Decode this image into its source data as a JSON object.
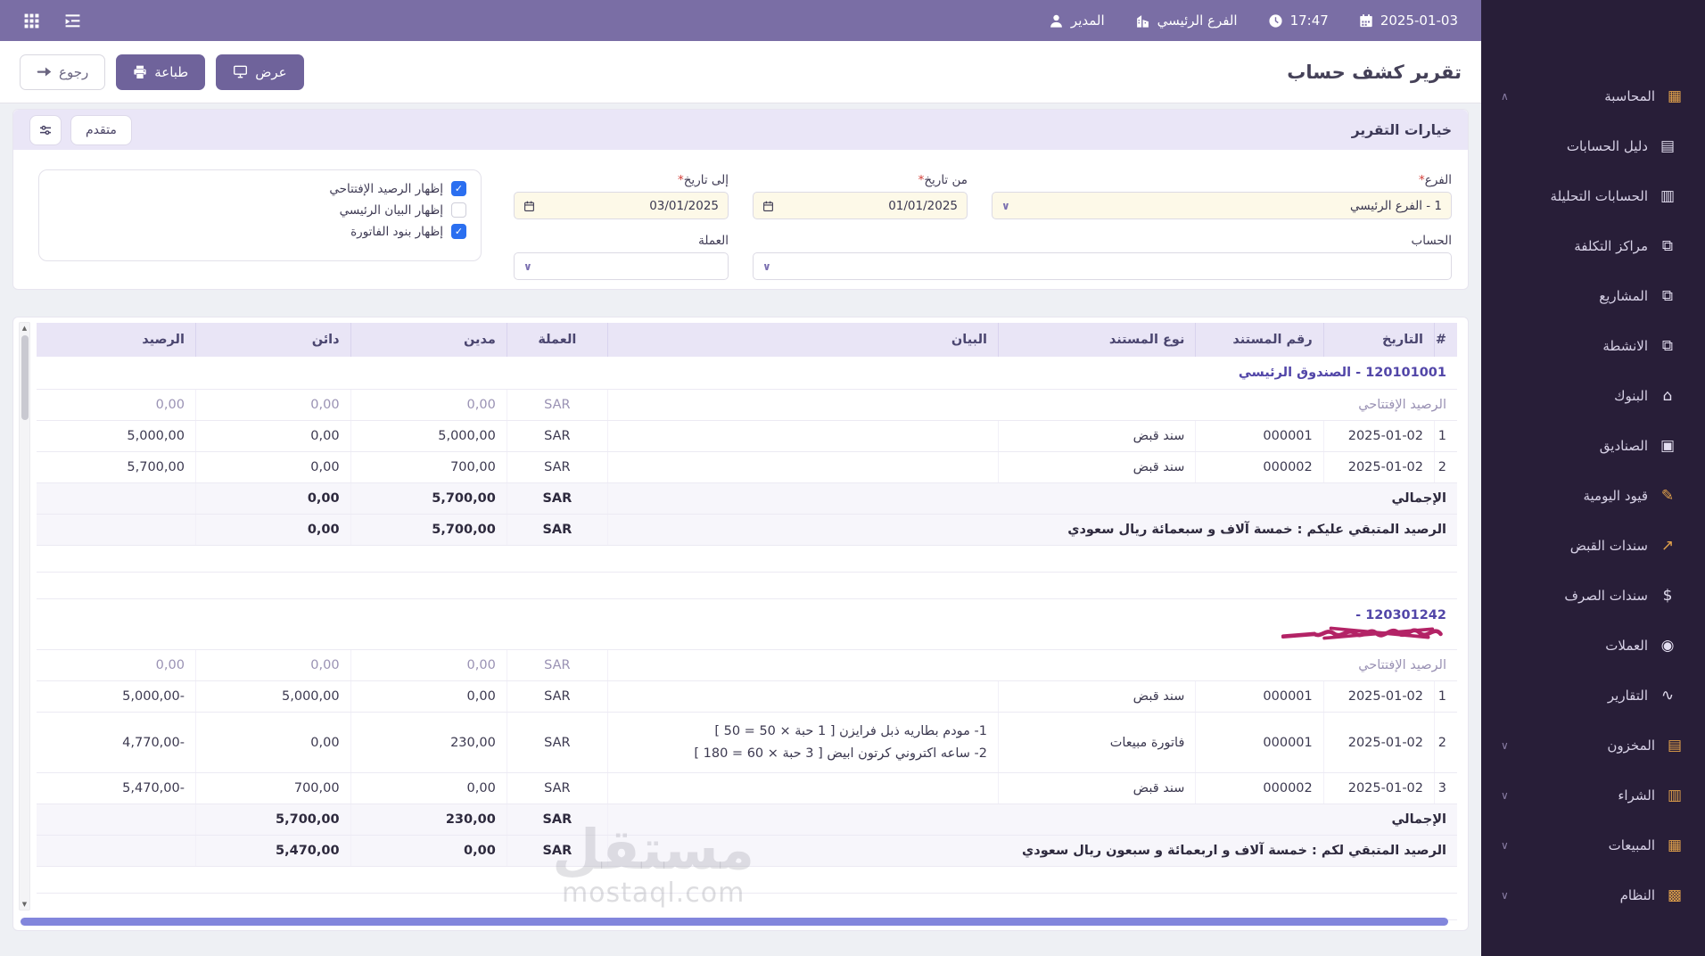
{
  "colors": {
    "accent": "#6F639B",
    "topbar": "#7A6EA5",
    "sidebar": "#281E38",
    "options_header": "#EAE6F7",
    "checkbox_checked": "#2B6FF0",
    "highlight_input": "#FDF9E8",
    "account_link": "#5246A8",
    "scribble": "#B32366",
    "hscrollbar": "#8286DC"
  },
  "topbar": {
    "user": "المدير",
    "branch": "الفرع الرئيسي",
    "time": "17:47",
    "date": "2025-01-03"
  },
  "toolbar": {
    "title": "تقرير كشف حساب",
    "view_label": "عرض",
    "print_label": "طباعة",
    "back_label": "رجوع"
  },
  "options": {
    "header": "خيارات التقرير",
    "advanced_label": "متقدم",
    "required_mark": "*",
    "fields": {
      "branch": {
        "label": "الفرع",
        "required": true,
        "value": "1 - الفرع الرئيسي"
      },
      "account": {
        "label": "الحساب",
        "value": ""
      },
      "from_date": {
        "label": "من تاريخ",
        "required": true,
        "value": "01/01/2025"
      },
      "to_date": {
        "label": "إلى تاريخ",
        "required": true,
        "value": "03/01/2025"
      },
      "currency": {
        "label": "العملة",
        "value": ""
      }
    },
    "checkboxes": [
      {
        "key": "show-opening-balance",
        "label": "إظهار الرصيد الإفتتاحي",
        "checked": true
      },
      {
        "key": "show-main-statement",
        "label": "إظهار البيان الرئيسي",
        "checked": false
      },
      {
        "key": "show-invoice-items",
        "label": "إظهار بنود الفاتورة",
        "checked": true
      }
    ]
  },
  "table": {
    "columns": [
      "#",
      "التاريخ",
      "رقم المستند",
      "نوع المستند",
      "البيان",
      "العملة",
      "مدين",
      "دائن",
      "الرصيد"
    ],
    "sections": [
      {
        "account": "120101001 - الصندوق الرئيسي",
        "redacted": false,
        "opening": {
          "label": "الرصيد الإفتتاحي",
          "currency": "SAR",
          "debit": "0,00",
          "credit": "0,00",
          "balance": "0,00"
        },
        "rows": [
          {
            "n": "1",
            "date": "2025-01-02",
            "doc_no": "000001",
            "doc_type": "سند قبض",
            "desc": [],
            "currency": "SAR",
            "debit": "5,000,00",
            "credit": "0,00",
            "balance": "5,000,00"
          },
          {
            "n": "2",
            "date": "2025-01-02",
            "doc_no": "000002",
            "doc_type": "سند قبض",
            "desc": [],
            "currency": "SAR",
            "debit": "700,00",
            "credit": "0,00",
            "balance": "5,700,00"
          }
        ],
        "total": {
          "label": "الإجمالي",
          "currency": "SAR",
          "debit": "5,700,00",
          "credit": "0,00",
          "balance": ""
        },
        "remaining": {
          "label": "الرصيد المتبقي عليكم : خمسة آلاف و سبعمائة ريال سعودي",
          "currency": "SAR",
          "debit": "5,700,00",
          "credit": "0,00",
          "balance": ""
        }
      },
      {
        "account": "120301242 - ",
        "redacted": true,
        "opening": {
          "label": "الرصيد الإفتتاحي",
          "currency": "SAR",
          "debit": "0,00",
          "credit": "0,00",
          "balance": "0,00"
        },
        "rows": [
          {
            "n": "1",
            "date": "2025-01-02",
            "doc_no": "000001",
            "doc_type": "سند قبض",
            "desc": [],
            "currency": "SAR",
            "debit": "0,00",
            "credit": "5,000,00",
            "balance": "5,000,00-"
          },
          {
            "n": "2",
            "date": "2025-01-02",
            "doc_no": "000001",
            "doc_type": "فاتورة مبيعات",
            "desc": [
              "1- مودم بطاريه ذبل فرايزن [ 1 حبة × 50 = 50 ]",
              "2- ساعه اكتروني كرتون ابيض [ 3 حبة × 60 = 180 ]"
            ],
            "currency": "SAR",
            "debit": "230,00",
            "credit": "0,00",
            "balance": "4,770,00-"
          },
          {
            "n": "3",
            "date": "2025-01-02",
            "doc_no": "000002",
            "doc_type": "سند قبض",
            "desc": [],
            "currency": "SAR",
            "debit": "0,00",
            "credit": "700,00",
            "balance": "5,470,00-"
          }
        ],
        "total": {
          "label": "الإجمالي",
          "currency": "SAR",
          "debit": "230,00",
          "credit": "5,700,00",
          "balance": ""
        },
        "remaining": {
          "label": "الرصيد المتبقي لكم : خمسة آلاف و اربعمائة و سبعون ريال سعودي",
          "currency": "SAR",
          "debit": "0,00",
          "credit": "5,470,00",
          "balance": ""
        }
      }
    ],
    "watermark": {
      "line1": "مستقل",
      "line2": "mostaql.com"
    }
  },
  "sidebar": {
    "items": [
      {
        "key": "accounting",
        "label": "المحاسبة",
        "icon": "accounting-icon",
        "chevron": "up",
        "sub": false,
        "colored": true
      },
      {
        "key": "chart-of-accounts",
        "label": "دليل الحسابات",
        "icon": "chart-of-accounts-icon",
        "chevron": null,
        "sub": true,
        "colored": false
      },
      {
        "key": "analytic-accounts",
        "label": "الحسابات التحليلة",
        "icon": "analytic-accounts-icon",
        "chevron": null,
        "sub": true,
        "colored": false
      },
      {
        "key": "cost-centers",
        "label": "مراكز التكلفة",
        "icon": "cost-centers-icon",
        "chevron": null,
        "sub": true,
        "colored": false
      },
      {
        "key": "projects",
        "label": "المشاريع",
        "icon": "projects-icon",
        "chevron": null,
        "sub": true,
        "colored": false
      },
      {
        "key": "activities",
        "label": "الانشطة",
        "icon": "activities-icon",
        "chevron": null,
        "sub": true,
        "colored": false
      },
      {
        "key": "banks",
        "label": "البنوك",
        "icon": "banks-icon",
        "chevron": null,
        "sub": true,
        "colored": false
      },
      {
        "key": "safes",
        "label": "الصناديق",
        "icon": "safes-icon",
        "chevron": null,
        "sub": true,
        "colored": false
      },
      {
        "key": "journal-entries",
        "label": "قيود اليومية",
        "icon": "journal-entries-icon",
        "chevron": null,
        "sub": true,
        "colored": true
      },
      {
        "key": "receipt-vouchers",
        "label": "سندات القبض",
        "icon": "receipt-vouchers-icon",
        "chevron": null,
        "sub": true,
        "colored": true
      },
      {
        "key": "payment-vouchers",
        "label": "سندات الصرف",
        "icon": "payment-vouchers-icon",
        "chevron": null,
        "sub": true,
        "colored": false
      },
      {
        "key": "currencies",
        "label": "العملات",
        "icon": "currencies-icon",
        "chevron": null,
        "sub": true,
        "colored": false
      },
      {
        "key": "reports",
        "label": "التقارير",
        "icon": "reports-icon",
        "chevron": null,
        "sub": true,
        "colored": false
      },
      {
        "key": "inventory",
        "label": "المخزون",
        "icon": "inventory-icon",
        "chevron": "down",
        "sub": false,
        "colored": true
      },
      {
        "key": "purchases",
        "label": "الشراء",
        "icon": "purchases-icon",
        "chevron": "down",
        "sub": false,
        "colored": true
      },
      {
        "key": "sales",
        "label": "المبيعات",
        "icon": "sales-icon",
        "chevron": "down",
        "sub": false,
        "colored": true
      },
      {
        "key": "system",
        "label": "النظام",
        "icon": "system-icon",
        "chevron": "down",
        "sub": false,
        "colored": true
      }
    ]
  }
}
